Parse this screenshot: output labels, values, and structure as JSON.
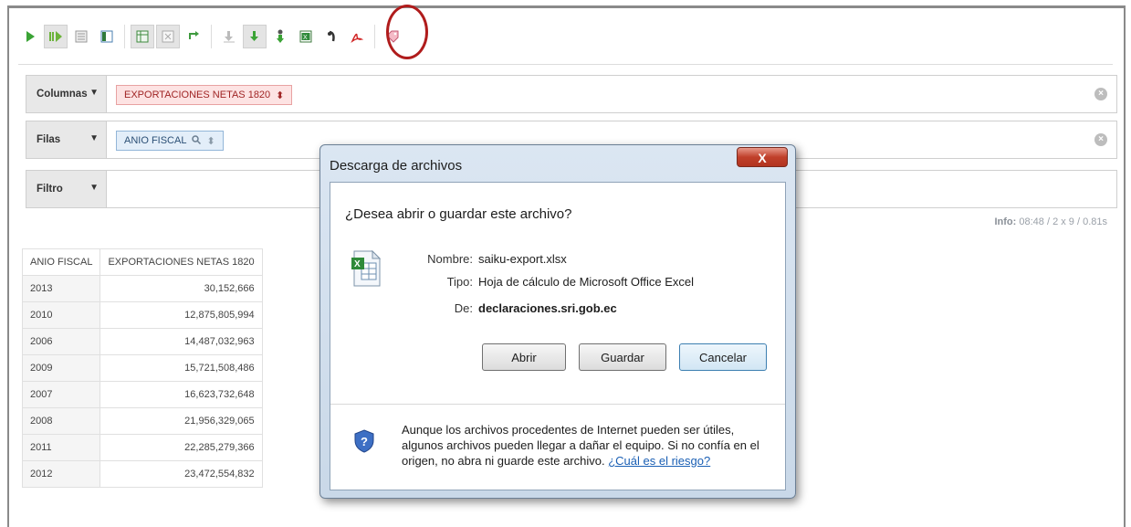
{
  "toolbar": {
    "icons": [
      "run-query-icon",
      "automatic-execution-icon",
      "toggle-fields-icon",
      "toggle-sidebar-icon",
      "hide-parents-icon",
      "non-empty-icon",
      "swap-axes-icon",
      "show-mdx-icon",
      "export-xls-icon",
      "export-csv-icon",
      "export-excel-icon",
      "show-chart-icon",
      "export-pdf-icon",
      "tag-icon"
    ]
  },
  "axes": {
    "columns": {
      "label": "Columnas",
      "chip": "EXPORTACIONES NETAS 1820"
    },
    "rows": {
      "label": "Filas",
      "chip": "ANIO FISCAL"
    },
    "filter": {
      "label": "Filtro"
    }
  },
  "info": {
    "label": "Info:",
    "text": "08:48  / 2 x 9  / 0.81s"
  },
  "table": {
    "headers": [
      "ANIO FISCAL",
      "EXPORTACIONES NETAS 1820"
    ],
    "rows": [
      [
        "2013",
        "30,152,666"
      ],
      [
        "2010",
        "12,875,805,994"
      ],
      [
        "2006",
        "14,487,032,963"
      ],
      [
        "2009",
        "15,721,508,486"
      ],
      [
        "2007",
        "16,623,732,648"
      ],
      [
        "2008",
        "21,956,329,065"
      ],
      [
        "2011",
        "22,285,279,366"
      ],
      [
        "2012",
        "23,472,554,832"
      ]
    ]
  },
  "dialog": {
    "title": "Descarga de archivos",
    "close": "X",
    "question": "¿Desea abrir o guardar este archivo?",
    "name_key": "Nombre:",
    "name_val": "saiku-export.xlsx",
    "type_key": "Tipo:",
    "type_val": "Hoja de cálculo de Microsoft Office Excel",
    "from_key": "De:",
    "from_val": "declaraciones.sri.gob.ec",
    "btn_open": "Abrir",
    "btn_save": "Guardar",
    "btn_cancel": "Cancelar",
    "warning": "Aunque los archivos procedentes de Internet pueden ser útiles, algunos archivos pueden llegar a dañar el equipo. Si no confía en el origen, no abra ni guarde este archivo.",
    "risk_link": "¿Cuál es el riesgo?"
  },
  "colors": {
    "accent_red": "#b01c1c",
    "chip_col": "#fde3e3",
    "chip_row": "#e3eef9"
  }
}
